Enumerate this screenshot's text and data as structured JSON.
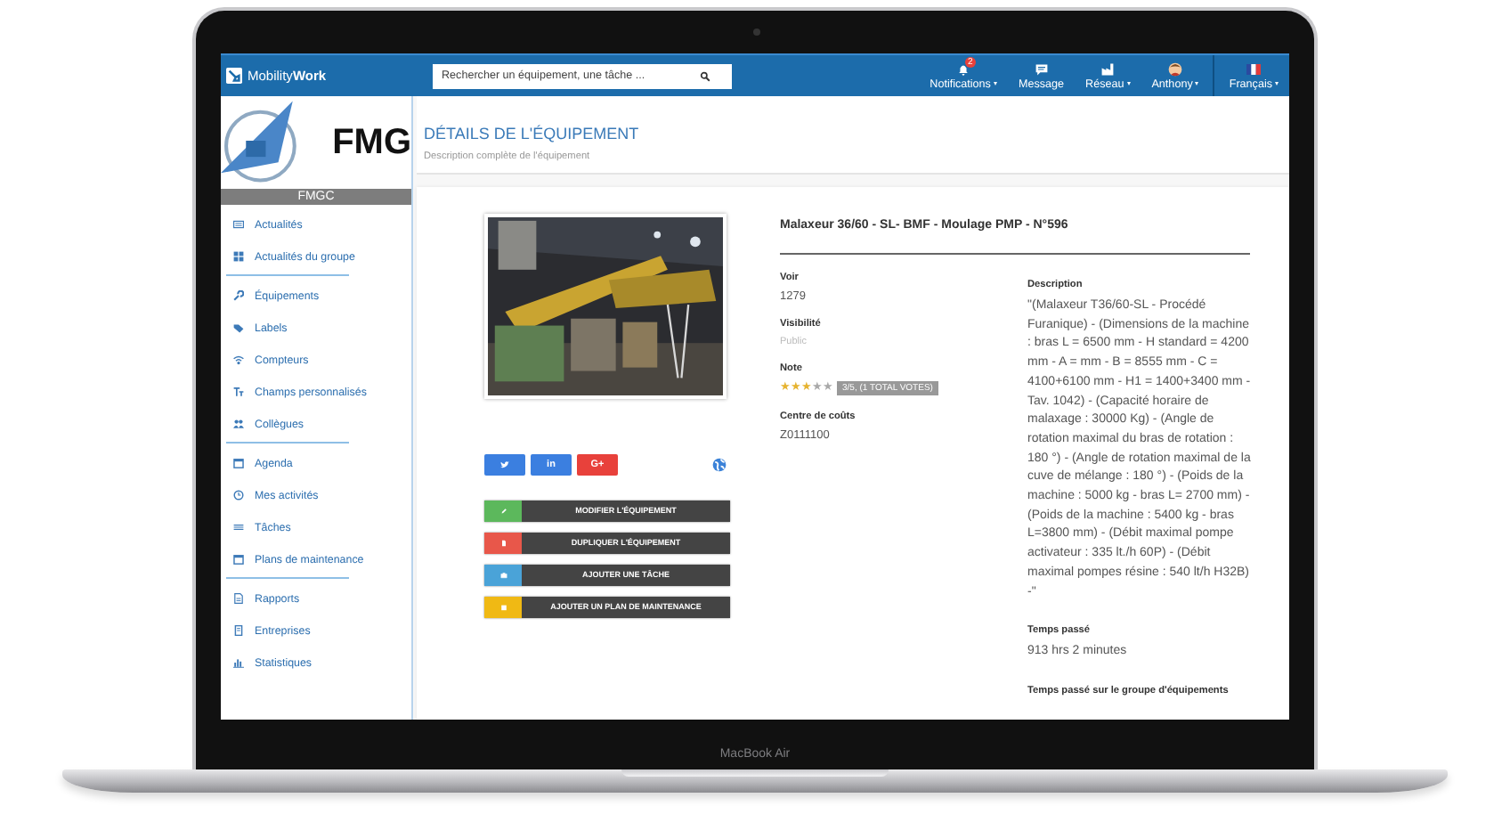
{
  "topbar": {
    "logo": "Mobility**Work**",
    "search": {
      "placeholder": "Rechercher un équipement, une tâche ..."
    },
    "nav": [
      {
        "label": "Notifications",
        "kind": "bell",
        "badge": "2",
        "dropdown": true
      },
      {
        "label": "Message",
        "kind": "chat",
        "dropdown": false
      },
      {
        "label": "Réseau",
        "kind": "network",
        "dropdown": true
      },
      {
        "label": "Anthony",
        "kind": "avatar",
        "dropdown": true
      },
      {
        "label": "Français",
        "kind": "flag",
        "dropdown": true
      }
    ]
  },
  "sidebar": {
    "logo": "FMG",
    "org": "FMGC",
    "groups": [
      {
        "items": [
          {
            "label": "Actualités",
            "kind": "news"
          },
          {
            "label": "Actualités du groupe",
            "kind": "grid"
          }
        ]
      },
      {
        "items": [
          {
            "label": "Équipements",
            "kind": "wrench"
          },
          {
            "label": "Labels",
            "kind": "tag"
          },
          {
            "label": "Compteurs",
            "kind": "wifi"
          },
          {
            "label": "Champs personnalisés",
            "kind": "font"
          },
          {
            "label": "Collègues",
            "kind": "users"
          }
        ]
      },
      {
        "items": [
          {
            "label": "Agenda",
            "kind": "calendar"
          },
          {
            "label": "Mes activités",
            "kind": "clock"
          },
          {
            "label": "Tâches",
            "kind": "list"
          },
          {
            "label": "Plans de maintenance",
            "kind": "calendar"
          }
        ]
      },
      {
        "items": [
          {
            "label": "Rapports",
            "kind": "report"
          },
          {
            "label": "Entreprises",
            "kind": "building"
          },
          {
            "label": "Statistiques",
            "kind": "chart"
          }
        ]
      }
    ]
  },
  "page": {
    "title": "DÉTAILS DE L'ÉQUIPEMENT",
    "subtitle": "Description complète de l'équipement"
  },
  "equipment": {
    "share": [
      {
        "kind": "twitter"
      },
      {
        "kind": "linkedin",
        "label": "in"
      },
      {
        "kind": "google",
        "label": "G+"
      }
    ],
    "actions": [
      {
        "label": "MODIFIER L'ÉQUIPEMENT",
        "kind": "edit",
        "color": "#5cb85c"
      },
      {
        "label": "DUPLIQUER L'ÉQUIPEMENT",
        "kind": "copy",
        "color": "#e8574a"
      },
      {
        "label": "AJOUTER UNE TÂCHE",
        "kind": "task",
        "color": "#4aa3d8"
      },
      {
        "label": "AJOUTER UN PLAN DE MAINTENANCE",
        "kind": "plan",
        "color": "#f0b914"
      }
    ],
    "name": "Malaxeur 36/60 - SL- BMF - Moulage PMP - N°596",
    "fields": [
      {
        "label": "Voir",
        "kind": "text",
        "value": "1279"
      },
      {
        "label": "Visibilité",
        "kind": "muted",
        "value": "Public"
      },
      {
        "label": "Note",
        "kind": "rating",
        "stars": 3,
        "value": "3/5, (1 TOTAL VOTES)"
      },
      {
        "label": "Centre de coûts",
        "kind": "text",
        "value": "Z0111100"
      }
    ],
    "details": [
      {
        "label": "Description",
        "value": "\"(Malaxeur T36/60-SL - Procédé Furanique) - (Dimensions de la machine : bras L = 6500 mm - H standard = 4200 mm - A = mm - B = 8555 mm - C = 4100+6100 mm - H1 = 1400+3400 mm - Tav. 1042) - (Capacité horaire de malaxage : 30000 Kg) - (Angle de rotation maximal du bras de rotation : 180 °) - (Angle de rotation maximal de la cuve de mélange : 180 °) - (Poids de la machine : 5000 kg - bras L= 2700 mm) - (Poids de la machine : 5400 kg - bras L=3800 mm) - (Débit maximal pompe activateur : 335 lt./h 60P) - (Débit maximal pompes résine : 540 lt/h H32B) -\""
      },
      {
        "label": "Temps passé",
        "value": "913 hrs 2 minutes"
      },
      {
        "label": "Temps passé sur le groupe d'équipements"
      }
    ]
  },
  "device": {
    "label": "MacBook Air"
  }
}
